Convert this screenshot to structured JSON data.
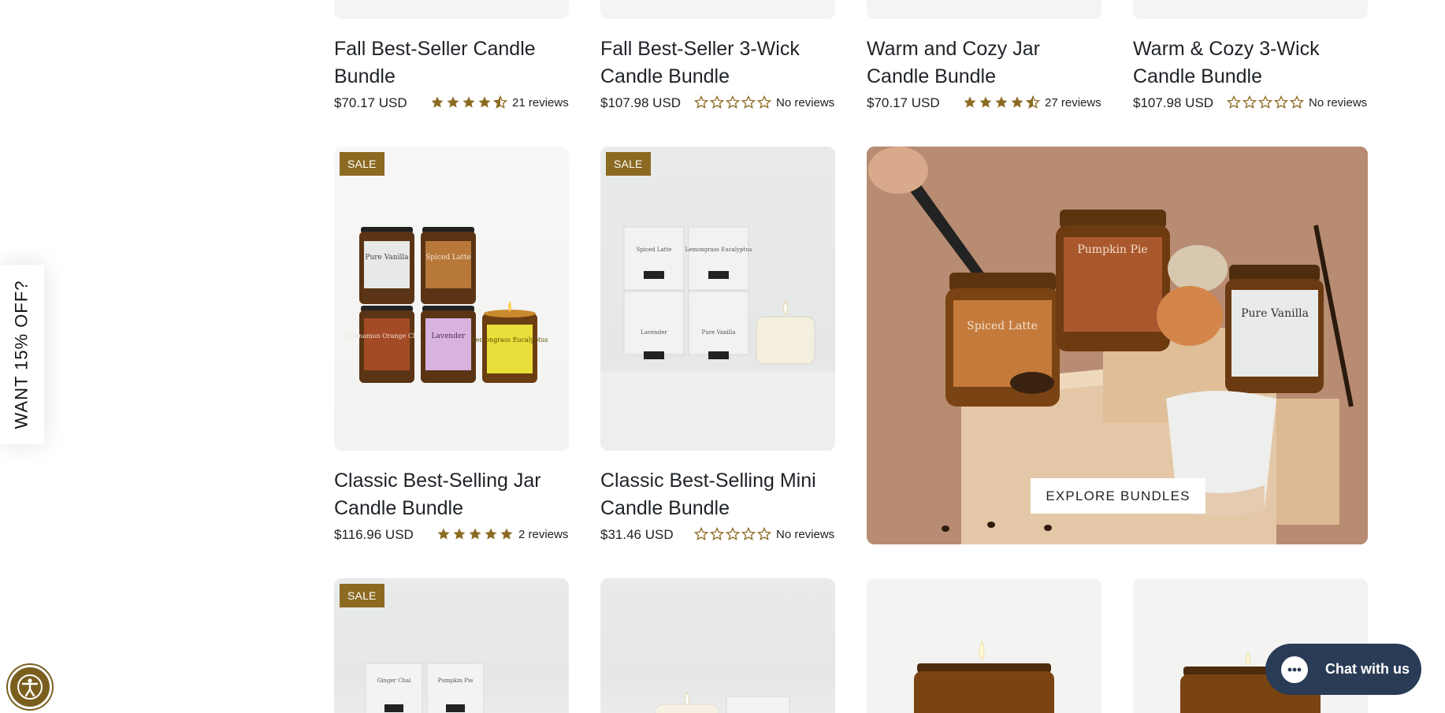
{
  "side_tab": {
    "label": "WANT 15% OFF?"
  },
  "row1": [
    {
      "title_line1": "Fall Best-Seller Candle",
      "title_line2": "Bundle",
      "price": "$70.17 USD",
      "rating": 4.5,
      "reviews": "21 reviews"
    },
    {
      "title_line1": "Fall Best-Seller 3-Wick",
      "title_line2": "Candle Bundle",
      "price": "$107.98 USD",
      "rating": 0,
      "reviews": "No reviews"
    },
    {
      "title_line1": "Warm and Cozy Jar",
      "title_line2": "Candle Bundle",
      "price": "$70.17 USD",
      "rating": 4.5,
      "reviews": "27 reviews"
    },
    {
      "title_line1": "Warm & Cozy 3-Wick",
      "title_line2": "Candle Bundle",
      "price": "$107.98 USD",
      "rating": 0,
      "reviews": "No reviews"
    }
  ],
  "row2": [
    {
      "badge": "SALE",
      "title_line1": "Classic Best-Selling Jar",
      "title_line2": "Candle Bundle",
      "price": "$116.96 USD",
      "rating": 5,
      "reviews": "2 reviews",
      "jar_labels": [
        "Pure Vanilla",
        "Spiced Latte",
        "Cinnamon Orange Clove",
        "Lavender",
        "Lemongrass Eucalyptus"
      ]
    },
    {
      "badge": "SALE",
      "title_line1": "Classic Best-Selling Mini",
      "title_line2": "Candle Bundle",
      "price": "$31.46 USD",
      "rating": 0,
      "reviews": "No reviews",
      "box_labels": [
        "Spiced Latte",
        "Lemongrass Eucalyptus",
        "Lavender",
        "Pure Vanilla"
      ]
    }
  ],
  "promo": {
    "button_label": "EXPLORE BUNDLES",
    "jar_labels": [
      "Spiced Latte",
      "Pumpkin Pie",
      "Pure Vanilla"
    ]
  },
  "row3": [
    {
      "badge": "SALE",
      "box_labels": [
        "Ginger Chai",
        "Pumpkin Pie"
      ]
    }
  ],
  "chat": {
    "label": "Chat with us"
  },
  "colors": {
    "accent": "#8c6a22",
    "star": "#8c6a22",
    "chat_bg": "#2a3b56"
  }
}
